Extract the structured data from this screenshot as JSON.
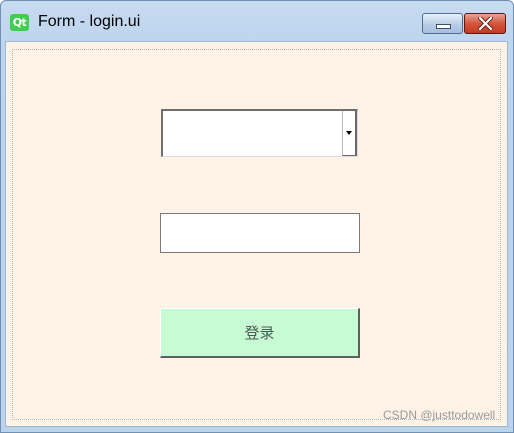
{
  "window": {
    "app_icon_text": "Qt",
    "title": "Form - login.ui",
    "minimize_icon": "minimize-icon",
    "close_icon": "close-icon"
  },
  "form": {
    "combo_value": "",
    "line_edit_value": "",
    "login_label": "登录"
  },
  "watermark": "CSDN @justtodowell",
  "colors": {
    "form_background": "#fff3e8",
    "login_button_background": "#c6fbd4",
    "qt_green": "#41cd52",
    "close_red": "#c23b22"
  }
}
